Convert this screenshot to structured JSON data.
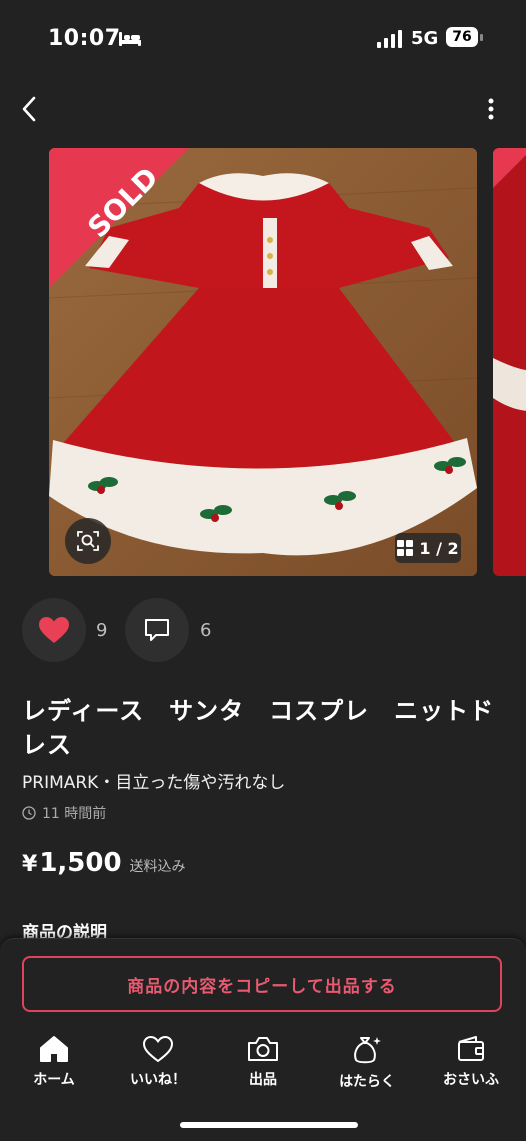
{
  "status_bar": {
    "time": "10:07",
    "network": "5G",
    "battery": "76"
  },
  "product": {
    "sold_label": "SOLD",
    "image_counter": "1 / 2",
    "likes": "9",
    "comments": "6",
    "title": "レディース　サンタ　コスプレ　ニットドレス",
    "brand_condition": "PRIMARK・目立った傷や汚れなし",
    "posted_time": "11 時間前",
    "price_symbol": "¥",
    "price": "1,500",
    "shipping_note": "送料込み",
    "description_heading": "商品の説明"
  },
  "actions": {
    "copy_listing_label": "商品の内容をコピーして出品する"
  },
  "tabs": [
    {
      "label": "ホーム",
      "icon": "home-icon"
    },
    {
      "label": "いいね！",
      "icon": "heart-icon"
    },
    {
      "label": "出品",
      "icon": "camera-icon"
    },
    {
      "label": "はたらく",
      "icon": "bag-icon"
    },
    {
      "label": "おさいふ",
      "icon": "wallet-icon"
    }
  ],
  "colors": {
    "accent": "#e63950",
    "background": "#222222",
    "like_red": "#e84055"
  }
}
